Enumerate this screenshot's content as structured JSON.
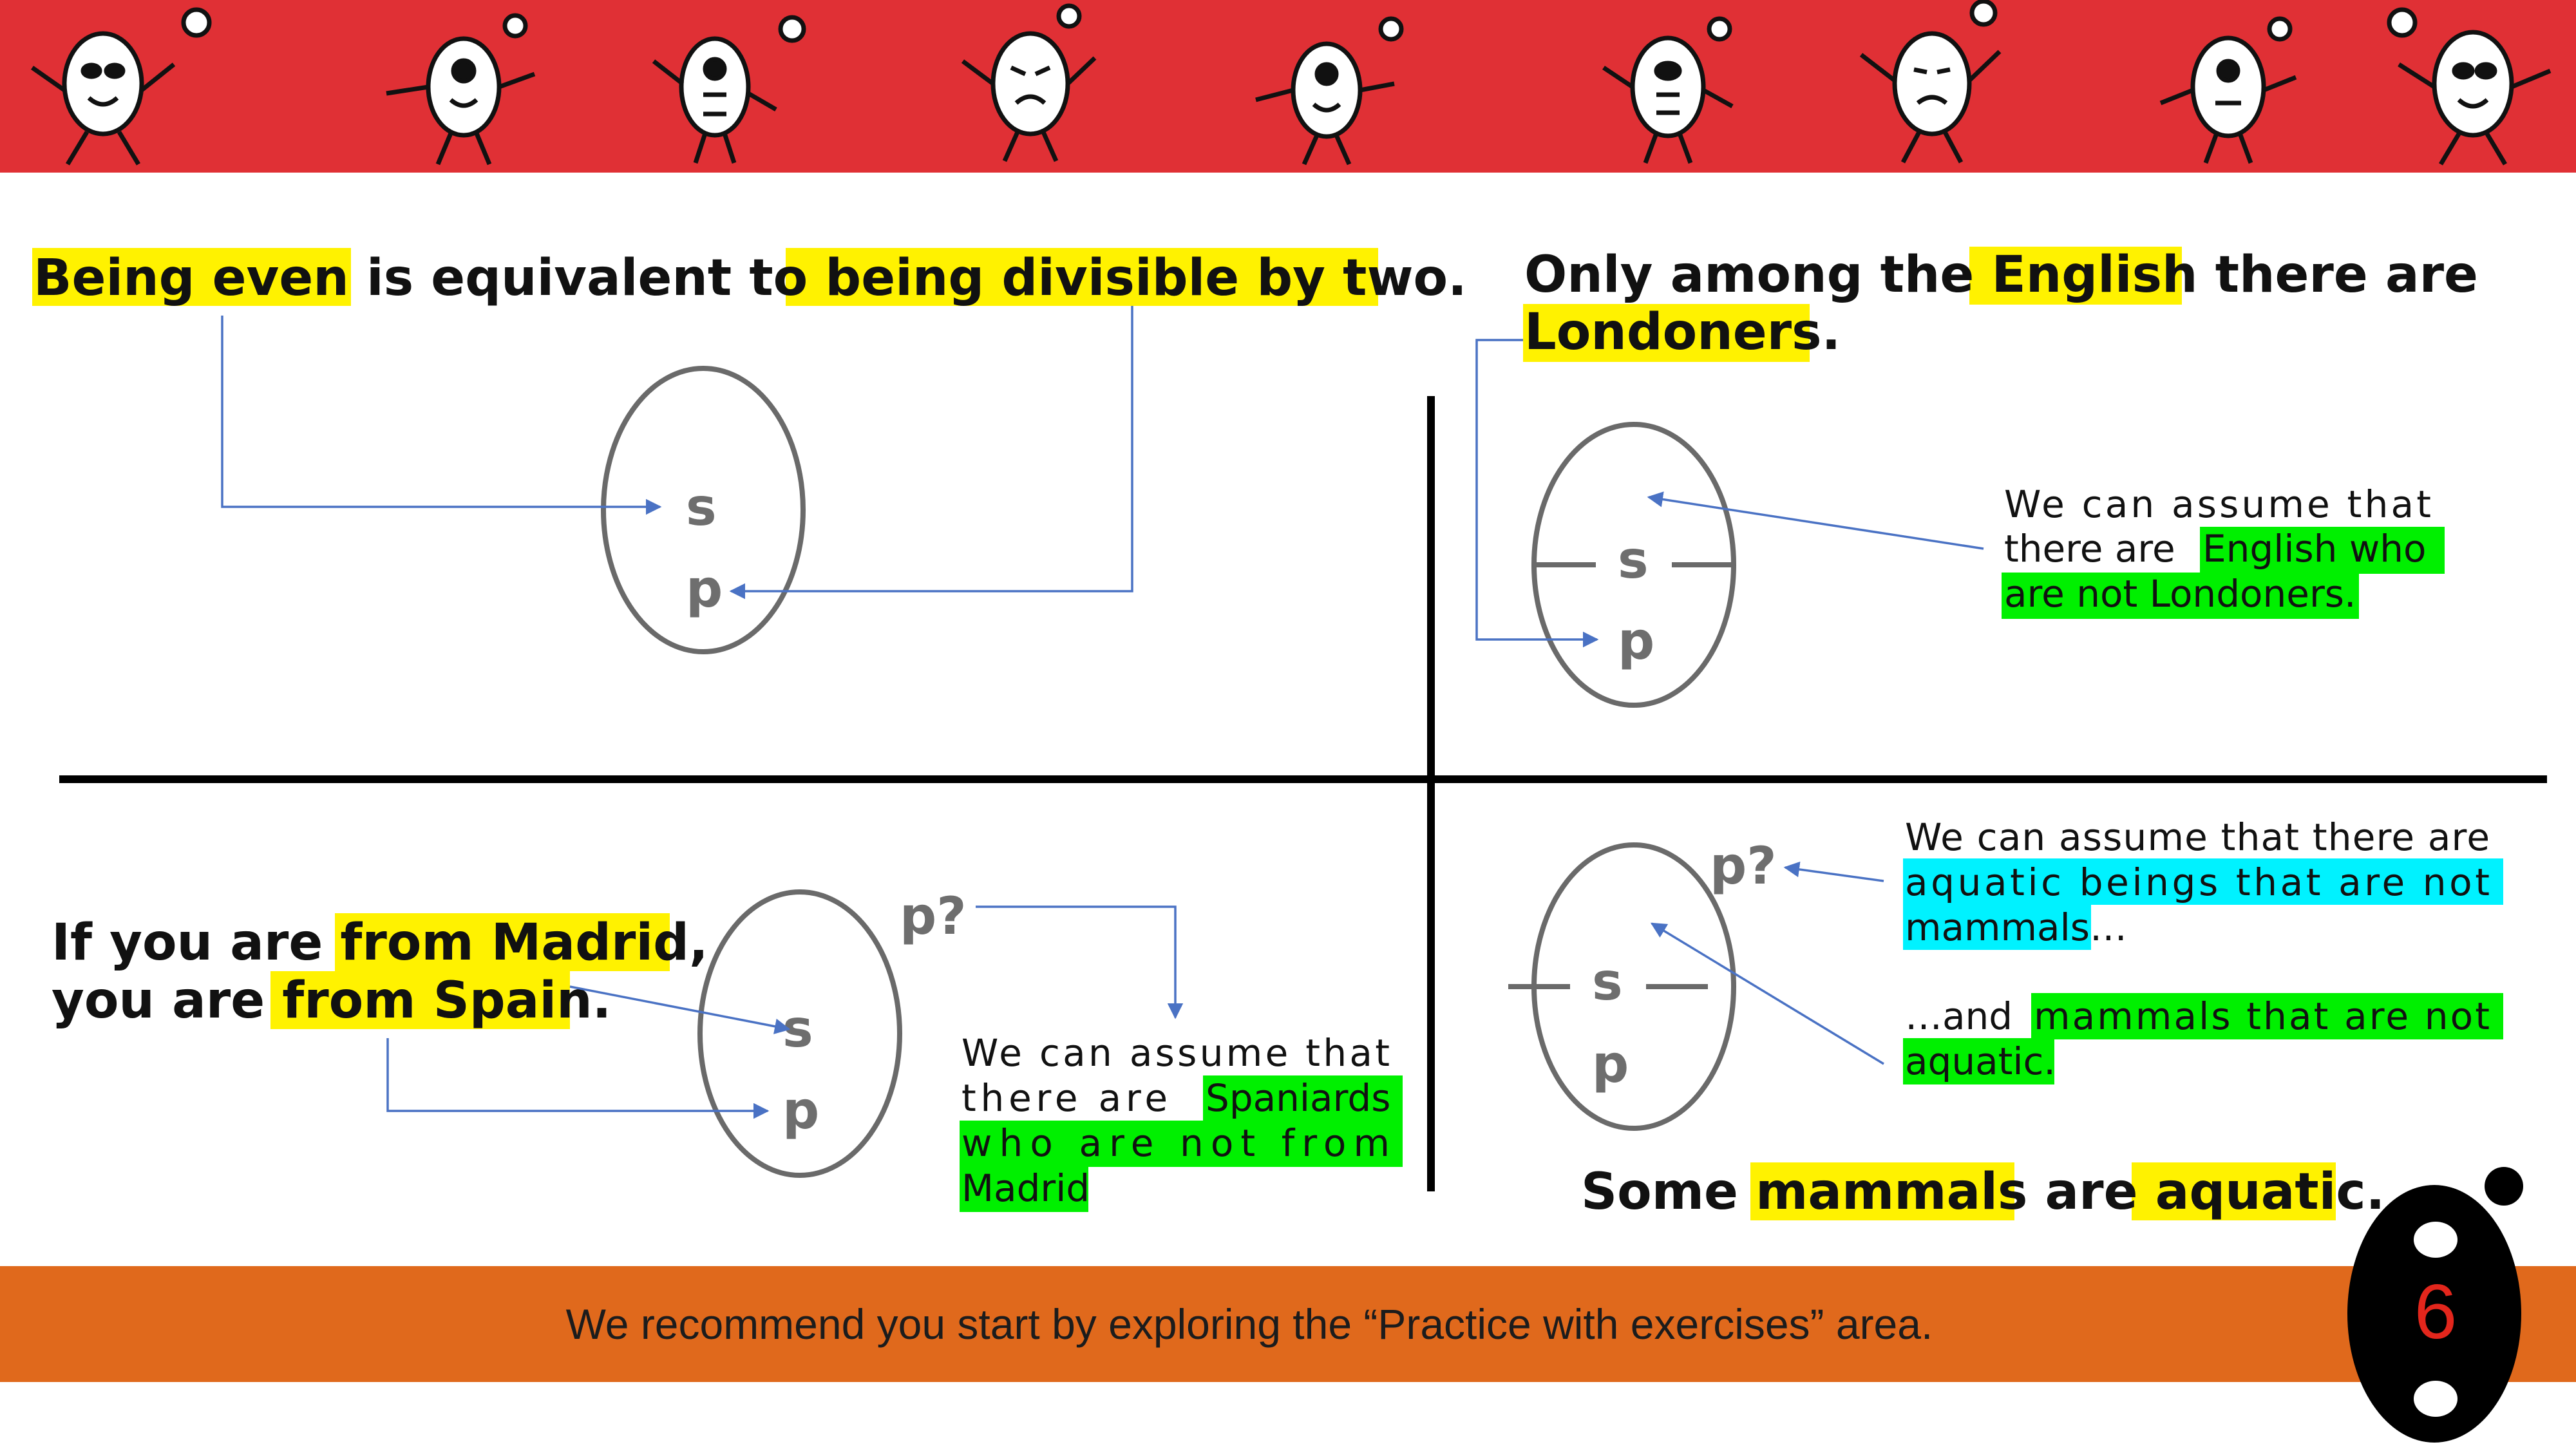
{
  "footer": {
    "text": "We recommend you start by exploring the “Practice with exercises” area."
  },
  "page_number": "6",
  "colors": {
    "banner": "#e03035",
    "footer_bar": "#e0691c",
    "highlight_yellow": "#fff200",
    "highlight_green": "#00f000",
    "highlight_cyan": "#00f2ff",
    "arrow": "#4a72c4"
  },
  "panels": {
    "top_left": {
      "statement": {
        "part1": "Being even",
        "part2": " is equivalent to ",
        "part3": "being divisible by two",
        "part4": "."
      },
      "labels": {
        "s": "s",
        "p": "p"
      }
    },
    "top_right": {
      "statement": {
        "line1_a": "Only among the ",
        "line1_b": "English",
        "line1_c": " there are",
        "line2_a": "Londoners",
        "line2_b": "."
      },
      "labels": {
        "s": "s",
        "p": "p"
      },
      "note": {
        "line1": "We can assume that",
        "line2_a": "there are",
        "line2_b": "English who",
        "line3": "are not Londoners."
      }
    },
    "bottom_left": {
      "statement": {
        "line1_a": "If you are ",
        "line1_b": "from Madrid",
        "line1_c": ",",
        "line2_a": "you are ",
        "line2_b": "from Spain",
        "line2_c": "."
      },
      "labels": {
        "s": "s",
        "p": "p",
        "p_question": "p?"
      },
      "note": {
        "line1": "We can assume that",
        "line2_a": "there are",
        "line2_b": "Spaniards",
        "line3": "who are not from",
        "line4": "Madrid"
      }
    },
    "bottom_right": {
      "statement": {
        "a": "Some ",
        "b": "mammals",
        "c": " are ",
        "d": "aquatic",
        "e": "."
      },
      "labels": {
        "s": "s",
        "p": "p",
        "p_question": "p?"
      },
      "note1": {
        "line1": "We can assume that there are",
        "line2": "aquatic beings that are not",
        "line3_a": "mammals",
        "line3_b": "…"
      },
      "note2": {
        "line1_a": "…and",
        "line1_b": "mammals that are not",
        "line2": "aquatic."
      }
    }
  }
}
